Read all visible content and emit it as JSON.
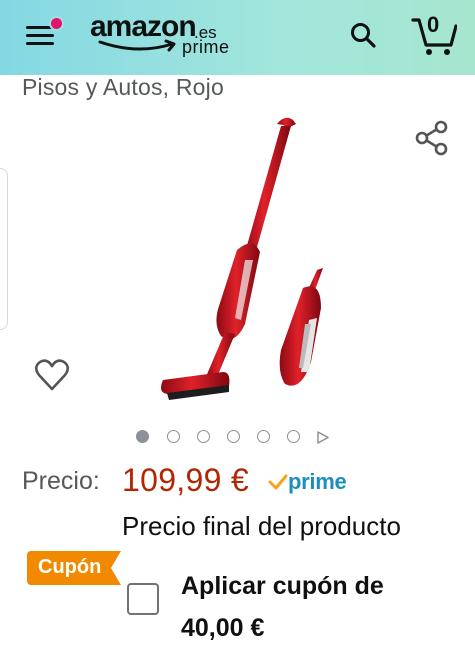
{
  "header": {
    "logo_text": "amazon",
    "logo_suffix": ".es",
    "logo_sub": "prime",
    "cart_count": "0",
    "colors": {
      "gradient_start": "#84d8e3",
      "gradient_end": "#a6e6cf",
      "notification_dot": "#e2136e"
    },
    "icons": [
      "menu-icon",
      "search-icon",
      "cart-icon"
    ]
  },
  "product": {
    "title_fragment": "Pisos y Autos, Rojo",
    "image_count": 6,
    "active_image": 1,
    "icons": [
      "share-icon",
      "heart-icon"
    ]
  },
  "pricing": {
    "price_label": "Precio:",
    "price": "109,99 €",
    "prime_label": "prime",
    "final_note": "Precio final del producto",
    "price_color": "#b12704"
  },
  "coupon": {
    "badge": "Cupón",
    "line1": "Aplicar cupón de",
    "line2": "40,00 €",
    "checked": false,
    "badge_color": "#f18a00"
  }
}
